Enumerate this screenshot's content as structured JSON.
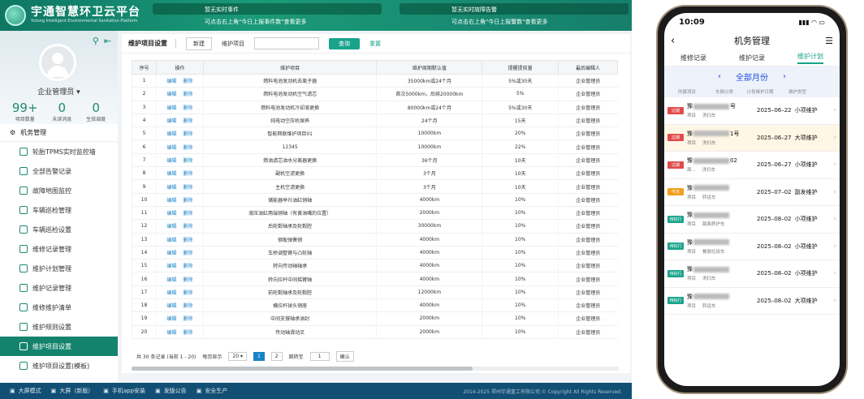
{
  "app": {
    "title": "宇通智慧环卫云平台",
    "subtitle": "Yutong Intelligent Environmental Sanitation Platform"
  },
  "notices": [
    {
      "title": "暂无实时事件",
      "hint": "可点击右上角\"今日上报事件数\"查看更多"
    },
    {
      "title": "暂无实时故障告警",
      "hint": "可点击右上角\"今日上报警数\"查看更多"
    }
  ],
  "user": {
    "name": "企业管理员",
    "stats": [
      {
        "n": "99+",
        "l": "项目数量"
      },
      {
        "n": "0",
        "l": "未读消息"
      },
      {
        "n": "0",
        "l": "生效调度"
      }
    ]
  },
  "menu": {
    "head": "机务管理",
    "items": [
      "轮胎TPMS实时监控墙",
      "全部告警记录",
      "故障地图监控",
      "车辆巡检管理",
      "车辆巡检设置",
      "维修记录管理",
      "维护计划管理",
      "维护记录管理",
      "维修维护清单",
      "维护规则设置",
      "维护项目设置",
      "维护项目设置(模板)"
    ],
    "active_index": 10
  },
  "toolbar": {
    "title": "维护项目设置",
    "new": "新建",
    "label": "维护项目",
    "query": "查询",
    "reset": "重置"
  },
  "table": {
    "headers": [
      "序号",
      "操作",
      "维护项目",
      "维护周期默认值",
      "提醒提前量",
      "最后编辑人"
    ],
    "edit": "编辑",
    "del": "删除",
    "rows": [
      [
        "1",
        "燃料电池发动机去离子器",
        "35000km或24个月",
        "5%或30天",
        "企业管理员"
      ],
      [
        "2",
        "燃料电池发动机空气滤芯",
        "首次5000km，后续20000km",
        "5%",
        "企业管理员"
      ],
      [
        "3",
        "燃料电池发动机冷却液更换",
        "80000km或24个月",
        "5%或30天",
        "企业管理员"
      ],
      [
        "4",
        "纯电动空压机保养",
        "24个月",
        "15天",
        "企业管理员"
      ],
      [
        "5",
        "智能网联维护项目01",
        "10000km",
        "20%",
        "企业管理员"
      ],
      [
        "6",
        "12345",
        "10000km",
        "22%",
        "企业管理员"
      ],
      [
        "7",
        "燃油滤芯油水分离器更换",
        "36个月",
        "10天",
        "企业管理员"
      ],
      [
        "8",
        "副机空滤更换",
        "3个月",
        "10天",
        "企业管理员"
      ],
      [
        "9",
        "主机空滤更换",
        "3个月",
        "10天",
        "企业管理员"
      ],
      [
        "10",
        "储能器举升油缸销轴",
        "4000km",
        "10%",
        "企业管理员"
      ],
      [
        "11",
        "液压油缸两端销轴（有黄油嘴的位置）",
        "2000km",
        "10%",
        "企业管理员"
      ],
      [
        "12",
        "后轮毂轴承及轮毂腔",
        "30000km",
        "10%",
        "企业管理员"
      ],
      [
        "13",
        "钢板弹簧销",
        "4000km",
        "10%",
        "企业管理员"
      ],
      [
        "14",
        "车桥调整臂与凸轮轴",
        "4000km",
        "10%",
        "企业管理员"
      ],
      [
        "15",
        "转向传动轴轴承",
        "4000km",
        "10%",
        "企业管理员"
      ],
      [
        "16",
        "转向拉杆中间摇臂轴",
        "4000km",
        "10%",
        "企业管理员"
      ],
      [
        "17",
        "前轮毂轴承及轮毂腔",
        "12000km",
        "10%",
        "企业管理员"
      ],
      [
        "18",
        "横拉杆球头销座",
        "4000km",
        "10%",
        "企业管理员"
      ],
      [
        "19",
        "中间支撑轴承油封",
        "2000km",
        "10%",
        "企业管理员"
      ],
      [
        "20",
        "传动轴滑动叉",
        "2000km",
        "10%",
        "企业管理员"
      ]
    ]
  },
  "pager": {
    "total": "共 30 条记录 (当前 1 - 20)",
    "per_label": "每页显示",
    "per": "20",
    "p1": "1",
    "p2": "2",
    "jump": "跳转至",
    "jump_val": "1",
    "ok": "确认"
  },
  "bottombar": {
    "items": [
      "大屏模式",
      "大屏（新版）",
      "手机app安装",
      "发版公告",
      "安全生产"
    ],
    "copy": "2014-2025 郑州宇通重工有限公司 © Copyright All Rights Reserved."
  },
  "phone": {
    "time": "10:09",
    "title": "机务管理",
    "tabs": [
      "维修记录",
      "维护记录",
      "维护计划"
    ],
    "active_tab": 2,
    "month": "全部月份",
    "cols": [
      "所属项目",
      "车辆分类",
      "计划维护日期",
      "维护类型"
    ],
    "rows": [
      {
        "tag": "过期",
        "color": "#e04b4b",
        "plate": "豫",
        "suffix": "号",
        "sub1": "项目",
        "sub2": "洗扫车",
        "date": "2025–06–22",
        "type": "小项维护",
        "hl": false
      },
      {
        "tag": "过期",
        "color": "#e04b4b",
        "plate": "豫",
        "suffix": "1号",
        "sub1": "项目",
        "sub2": "洗扫车",
        "date": "2025–06–27",
        "type": "大项维护",
        "hl": true
      },
      {
        "tag": "过期",
        "color": "#e04b4b",
        "plate": "豫",
        "suffix": "02",
        "sub1": "周...",
        "sub2": "洗扫车",
        "date": "2025–06–27",
        "type": "小项维护",
        "hl": false
      },
      {
        "tag": "今天",
        "color": "#f0a020",
        "plate": "豫",
        "suffix": "",
        "sub1": "项目",
        "sub2": "转运车",
        "date": "2025–07–02",
        "type": "副发维护",
        "hl": false
      },
      {
        "tag": "待执行",
        "color": "#19a38b",
        "plate": "豫",
        "suffix": "",
        "sub1": "项目",
        "sub2": "路面养护车",
        "date": "2025–08–02",
        "type": "小项维护",
        "hl": false
      },
      {
        "tag": "待执行",
        "color": "#19a38b",
        "plate": "豫",
        "suffix": "",
        "sub1": "项目",
        "sub2": "餐厨垃圾车",
        "date": "2025–08–02",
        "type": "小项维护",
        "hl": false
      },
      {
        "tag": "待执行",
        "color": "#19a38b",
        "plate": "豫",
        "suffix": "",
        "sub1": "项目",
        "sub2": "洗扫车",
        "date": "2025–08–02",
        "type": "小项维护",
        "hl": false
      },
      {
        "tag": "待执行",
        "color": "#19a38b",
        "plate": "豫",
        "suffix": "",
        "sub1": "项目",
        "sub2": "转运车",
        "date": "2025–08–02",
        "type": "大项维护",
        "hl": false
      }
    ]
  }
}
